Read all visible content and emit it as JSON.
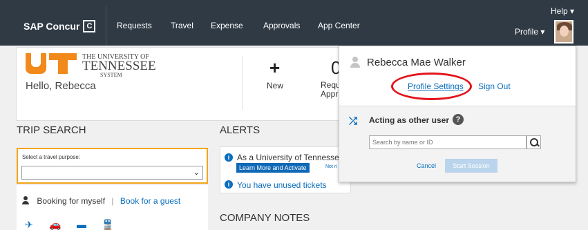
{
  "nav": {
    "brand": "SAP Concur",
    "brand_mark": "C",
    "items": [
      "Requests",
      "Travel",
      "Expense",
      "Approvals",
      "App Center"
    ],
    "help": "Help ▾",
    "profile": "Profile ▾"
  },
  "header": {
    "logo_line1": "THE UNIVERSITY OF",
    "logo_line2": "TENNESSEE",
    "logo_line3": "SYSTEM",
    "greeting": "Hello, Rebecca",
    "new_icon": "+",
    "new_label": "New",
    "requests_count": "0",
    "requests_label_1": "Requ",
    "requests_label_2": "Appr"
  },
  "trip_search": {
    "title": "TRIP SEARCH",
    "purpose_label": "Select a travel purpose:",
    "purpose_value": "",
    "chevron": "⌄",
    "booking_myself": "Booking for myself",
    "separator": "|",
    "booking_guest": "Book for a guest",
    "modes": [
      "flight-icon",
      "car-icon",
      "hotel-icon",
      "rail-icon"
    ],
    "mode_glyphs": [
      "✈",
      "🚗",
      "▬",
      "🚆"
    ]
  },
  "alerts": {
    "title": "ALERTS",
    "alert1": "As a University of Tennessee e",
    "learn_button": "Learn More and Activate",
    "not_label": "Not ri",
    "alert2": "You have unused tickets"
  },
  "company_notes": {
    "title": "COMPANY NOTES"
  },
  "profile_dropdown": {
    "name": "Rebecca Mae Walker",
    "profile_settings": "Profile Settings",
    "sign_out": "Sign Out",
    "acting_label": "Acting as other user",
    "help_glyph": "?",
    "search_placeholder": "Search by name or ID",
    "cancel": "Cancel",
    "start_session": "Start Session"
  },
  "colors": {
    "nav_bg": "#2f3a45",
    "accent_blue": "#0a6ebd",
    "ut_orange": "#f28a1b",
    "highlight_red": "#e3141b",
    "focus_orange": "#f2a51b"
  }
}
